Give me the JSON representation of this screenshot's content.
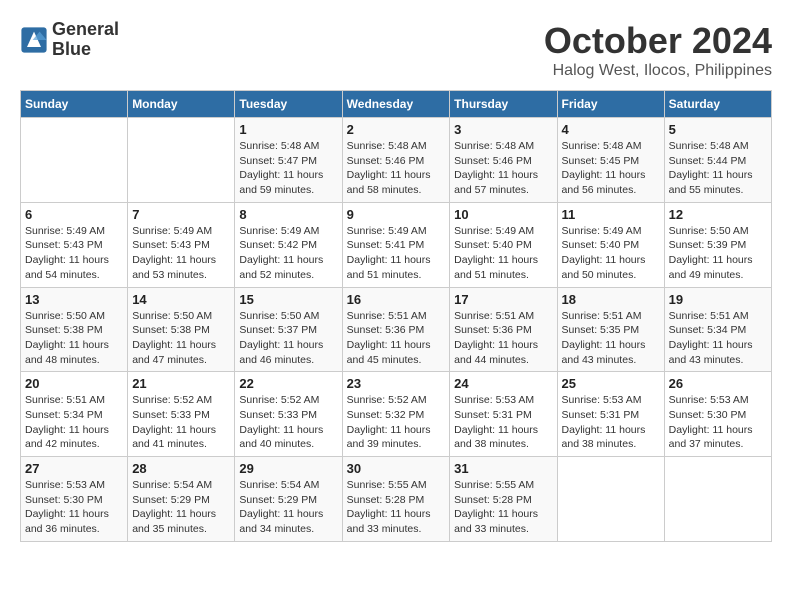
{
  "header": {
    "logo_line1": "General",
    "logo_line2": "Blue",
    "month": "October 2024",
    "location": "Halog West, Ilocos, Philippines"
  },
  "weekdays": [
    "Sunday",
    "Monday",
    "Tuesday",
    "Wednesday",
    "Thursday",
    "Friday",
    "Saturday"
  ],
  "weeks": [
    [
      {
        "day": "",
        "sunrise": "",
        "sunset": "",
        "daylight": ""
      },
      {
        "day": "",
        "sunrise": "",
        "sunset": "",
        "daylight": ""
      },
      {
        "day": "1",
        "sunrise": "Sunrise: 5:48 AM",
        "sunset": "Sunset: 5:47 PM",
        "daylight": "Daylight: 11 hours and 59 minutes."
      },
      {
        "day": "2",
        "sunrise": "Sunrise: 5:48 AM",
        "sunset": "Sunset: 5:46 PM",
        "daylight": "Daylight: 11 hours and 58 minutes."
      },
      {
        "day": "3",
        "sunrise": "Sunrise: 5:48 AM",
        "sunset": "Sunset: 5:46 PM",
        "daylight": "Daylight: 11 hours and 57 minutes."
      },
      {
        "day": "4",
        "sunrise": "Sunrise: 5:48 AM",
        "sunset": "Sunset: 5:45 PM",
        "daylight": "Daylight: 11 hours and 56 minutes."
      },
      {
        "day": "5",
        "sunrise": "Sunrise: 5:48 AM",
        "sunset": "Sunset: 5:44 PM",
        "daylight": "Daylight: 11 hours and 55 minutes."
      }
    ],
    [
      {
        "day": "6",
        "sunrise": "Sunrise: 5:49 AM",
        "sunset": "Sunset: 5:43 PM",
        "daylight": "Daylight: 11 hours and 54 minutes."
      },
      {
        "day": "7",
        "sunrise": "Sunrise: 5:49 AM",
        "sunset": "Sunset: 5:43 PM",
        "daylight": "Daylight: 11 hours and 53 minutes."
      },
      {
        "day": "8",
        "sunrise": "Sunrise: 5:49 AM",
        "sunset": "Sunset: 5:42 PM",
        "daylight": "Daylight: 11 hours and 52 minutes."
      },
      {
        "day": "9",
        "sunrise": "Sunrise: 5:49 AM",
        "sunset": "Sunset: 5:41 PM",
        "daylight": "Daylight: 11 hours and 51 minutes."
      },
      {
        "day": "10",
        "sunrise": "Sunrise: 5:49 AM",
        "sunset": "Sunset: 5:40 PM",
        "daylight": "Daylight: 11 hours and 51 minutes."
      },
      {
        "day": "11",
        "sunrise": "Sunrise: 5:49 AM",
        "sunset": "Sunset: 5:40 PM",
        "daylight": "Daylight: 11 hours and 50 minutes."
      },
      {
        "day": "12",
        "sunrise": "Sunrise: 5:50 AM",
        "sunset": "Sunset: 5:39 PM",
        "daylight": "Daylight: 11 hours and 49 minutes."
      }
    ],
    [
      {
        "day": "13",
        "sunrise": "Sunrise: 5:50 AM",
        "sunset": "Sunset: 5:38 PM",
        "daylight": "Daylight: 11 hours and 48 minutes."
      },
      {
        "day": "14",
        "sunrise": "Sunrise: 5:50 AM",
        "sunset": "Sunset: 5:38 PM",
        "daylight": "Daylight: 11 hours and 47 minutes."
      },
      {
        "day": "15",
        "sunrise": "Sunrise: 5:50 AM",
        "sunset": "Sunset: 5:37 PM",
        "daylight": "Daylight: 11 hours and 46 minutes."
      },
      {
        "day": "16",
        "sunrise": "Sunrise: 5:51 AM",
        "sunset": "Sunset: 5:36 PM",
        "daylight": "Daylight: 11 hours and 45 minutes."
      },
      {
        "day": "17",
        "sunrise": "Sunrise: 5:51 AM",
        "sunset": "Sunset: 5:36 PM",
        "daylight": "Daylight: 11 hours and 44 minutes."
      },
      {
        "day": "18",
        "sunrise": "Sunrise: 5:51 AM",
        "sunset": "Sunset: 5:35 PM",
        "daylight": "Daylight: 11 hours and 43 minutes."
      },
      {
        "day": "19",
        "sunrise": "Sunrise: 5:51 AM",
        "sunset": "Sunset: 5:34 PM",
        "daylight": "Daylight: 11 hours and 43 minutes."
      }
    ],
    [
      {
        "day": "20",
        "sunrise": "Sunrise: 5:51 AM",
        "sunset": "Sunset: 5:34 PM",
        "daylight": "Daylight: 11 hours and 42 minutes."
      },
      {
        "day": "21",
        "sunrise": "Sunrise: 5:52 AM",
        "sunset": "Sunset: 5:33 PM",
        "daylight": "Daylight: 11 hours and 41 minutes."
      },
      {
        "day": "22",
        "sunrise": "Sunrise: 5:52 AM",
        "sunset": "Sunset: 5:33 PM",
        "daylight": "Daylight: 11 hours and 40 minutes."
      },
      {
        "day": "23",
        "sunrise": "Sunrise: 5:52 AM",
        "sunset": "Sunset: 5:32 PM",
        "daylight": "Daylight: 11 hours and 39 minutes."
      },
      {
        "day": "24",
        "sunrise": "Sunrise: 5:53 AM",
        "sunset": "Sunset: 5:31 PM",
        "daylight": "Daylight: 11 hours and 38 minutes."
      },
      {
        "day": "25",
        "sunrise": "Sunrise: 5:53 AM",
        "sunset": "Sunset: 5:31 PM",
        "daylight": "Daylight: 11 hours and 38 minutes."
      },
      {
        "day": "26",
        "sunrise": "Sunrise: 5:53 AM",
        "sunset": "Sunset: 5:30 PM",
        "daylight": "Daylight: 11 hours and 37 minutes."
      }
    ],
    [
      {
        "day": "27",
        "sunrise": "Sunrise: 5:53 AM",
        "sunset": "Sunset: 5:30 PM",
        "daylight": "Daylight: 11 hours and 36 minutes."
      },
      {
        "day": "28",
        "sunrise": "Sunrise: 5:54 AM",
        "sunset": "Sunset: 5:29 PM",
        "daylight": "Daylight: 11 hours and 35 minutes."
      },
      {
        "day": "29",
        "sunrise": "Sunrise: 5:54 AM",
        "sunset": "Sunset: 5:29 PM",
        "daylight": "Daylight: 11 hours and 34 minutes."
      },
      {
        "day": "30",
        "sunrise": "Sunrise: 5:55 AM",
        "sunset": "Sunset: 5:28 PM",
        "daylight": "Daylight: 11 hours and 33 minutes."
      },
      {
        "day": "31",
        "sunrise": "Sunrise: 5:55 AM",
        "sunset": "Sunset: 5:28 PM",
        "daylight": "Daylight: 11 hours and 33 minutes."
      },
      {
        "day": "",
        "sunrise": "",
        "sunset": "",
        "daylight": ""
      },
      {
        "day": "",
        "sunrise": "",
        "sunset": "",
        "daylight": ""
      }
    ]
  ]
}
